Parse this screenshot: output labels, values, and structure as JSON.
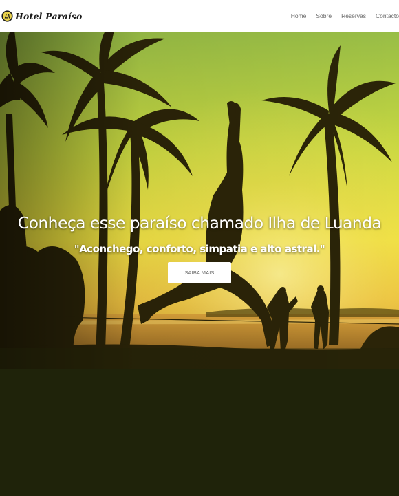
{
  "nav": {
    "brand": "Hotel Paraíso",
    "links": [
      "Home",
      "Sobre",
      "Reservas",
      "Contacto"
    ]
  },
  "hero": {
    "title": "Conheça esse paraíso chamado Ilha de Luanda",
    "subtitle": "\"Aconchego, conforto, simpatia e alto astral.\"",
    "button_label": "SAIBA MAIS"
  },
  "colors": {
    "navbar_bg": "#ffffff",
    "sky_top": "#a7c64a",
    "sky_mid": "#e9e63a",
    "sunset": "#f0c040",
    "silhouette": "#2b2408",
    "page_bg": "#1f230a",
    "button_bg": "#ffffff"
  }
}
